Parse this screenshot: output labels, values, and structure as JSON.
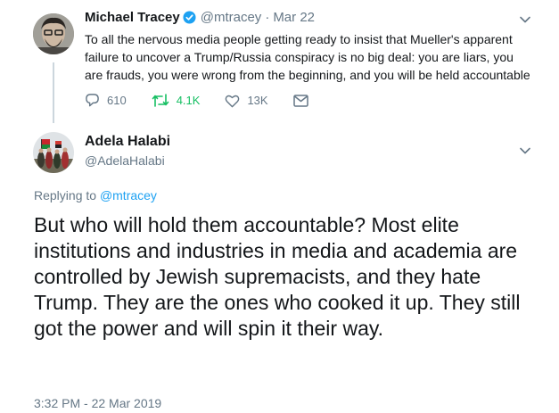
{
  "parent_tweet": {
    "author_name": "Michael Tracey",
    "author_handle": "@mtracey",
    "separator": "·",
    "date": "Mar 22",
    "text": "To all the nervous media people getting ready to insist that Mueller's apparent failure to uncover a Trump/Russia conspiracy is no big deal: you are liars, you are frauds, you were wrong from the beginning, and you will be held accountable",
    "actions": {
      "reply_count": "610",
      "retweet_count": "4.1K",
      "like_count": "13K"
    }
  },
  "reply_tweet": {
    "author_name": "Adela Halabi",
    "author_handle": "@AdelaHalabi",
    "replying_prefix": "Replying to",
    "replying_to": "@mtracey",
    "text": "But who will hold them accountable? Most elite institutions and industries in media and academia are controlled by Jewish supremacists, and they hate Trump. They are the ones who cooked it up. They still got the power and will spin it their way.",
    "timestamp": "3:32 PM - 22 Mar 2019"
  },
  "colors": {
    "link": "#1da1f2",
    "retweet": "#17bf63",
    "muted": "#657786",
    "text": "#14171a",
    "verified": "#1da1f2"
  },
  "icons": [
    "reply-icon",
    "retweet-icon",
    "like-icon",
    "message-icon",
    "verified-badge-icon",
    "chevron-down-icon"
  ]
}
